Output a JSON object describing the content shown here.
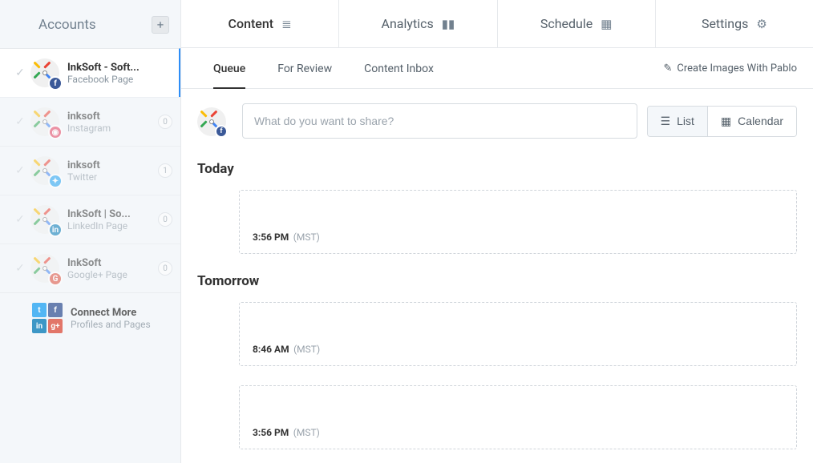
{
  "sidebar": {
    "title": "Accounts",
    "items": [
      {
        "name": "InkSoft - Soft...",
        "sub": "Facebook Page",
        "network": "facebook",
        "glyph": "f",
        "badge": null,
        "active": true
      },
      {
        "name": "inksoft",
        "sub": "Instagram",
        "network": "instagram",
        "glyph": "◉",
        "badge": "0",
        "active": false
      },
      {
        "name": "inksoft",
        "sub": "Twitter",
        "network": "twitter",
        "glyph": "✦",
        "badge": "1",
        "active": false
      },
      {
        "name": "InkSoft | So...",
        "sub": "LinkedIn Page",
        "network": "linkedin",
        "glyph": "in",
        "badge": "0",
        "active": false
      },
      {
        "name": "InkSoft",
        "sub": "Google+ Page",
        "network": "googleplus",
        "glyph": "G",
        "badge": "0",
        "active": false
      }
    ],
    "connect": {
      "name": "Connect More",
      "sub": "Profiles and Pages"
    }
  },
  "topnav": [
    {
      "label": "Content",
      "icon": "≣"
    },
    {
      "label": "Analytics",
      "icon": "▮▮"
    },
    {
      "label": "Schedule",
      "icon": "▦"
    },
    {
      "label": "Settings",
      "icon": "⚙"
    }
  ],
  "subnav": {
    "items": [
      "Queue",
      "For Review",
      "Content Inbox"
    ],
    "pablo": "Create Images With Pablo"
  },
  "composer": {
    "placeholder": "What do you want to share?",
    "list_label": "List",
    "calendar_label": "Calendar"
  },
  "queue": [
    {
      "label": "Today",
      "slots": [
        {
          "time": "3:56 PM",
          "tz": "(MST)"
        }
      ]
    },
    {
      "label": "Tomorrow",
      "slots": [
        {
          "time": "8:46 AM",
          "tz": "(MST)"
        },
        {
          "time": "3:56 PM",
          "tz": "(MST)"
        }
      ]
    }
  ]
}
